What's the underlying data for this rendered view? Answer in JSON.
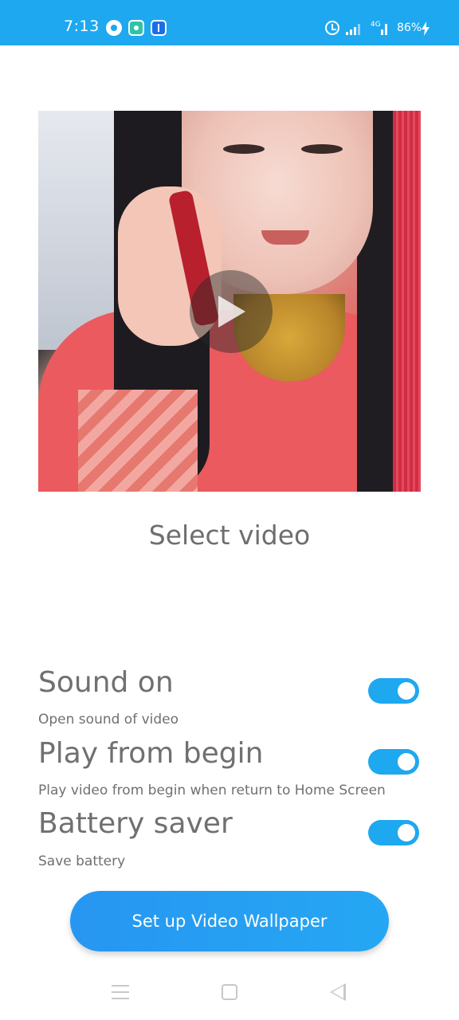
{
  "status_bar": {
    "time": "7:13",
    "network": "4G",
    "battery": "86%",
    "app_icons": [
      "circle-app-icon",
      "green-app-icon",
      "usb-icon"
    ],
    "right_icons": [
      "alarm-icon",
      "signal-icon",
      "signal-icon",
      "charging-bolt-icon"
    ]
  },
  "preview": {
    "play_icon": "play-icon"
  },
  "select_video_label": "Select video",
  "settings": [
    {
      "title": "Sound on",
      "description": "Open sound of video",
      "enabled": true
    },
    {
      "title": "Play from begin",
      "description": "Play video from begin when return to Home Screen",
      "enabled": true
    },
    {
      "title": "Battery saver",
      "description": "Save battery",
      "enabled": true
    }
  ],
  "cta_label": "Set up Video Wallpaper",
  "nav": {
    "icons": [
      "menu-icon",
      "home-icon",
      "back-icon"
    ]
  },
  "colors": {
    "accent": "#1ea8f0",
    "text": "#707070",
    "background": "#ffffff"
  }
}
